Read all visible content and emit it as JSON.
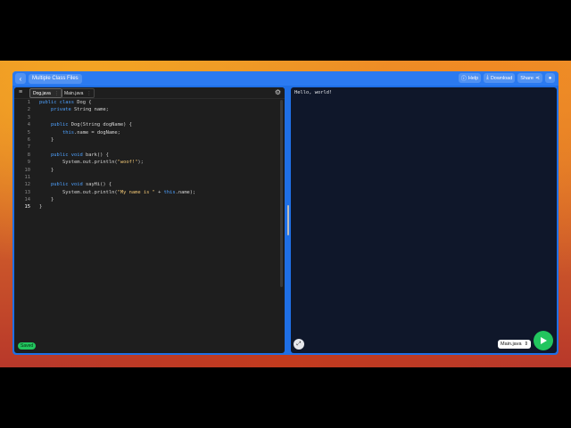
{
  "topbar": {
    "title": "Multiple Class Files",
    "help_label": "Help",
    "download_label": "Download",
    "share_label": "Share"
  },
  "editor": {
    "tabs": [
      {
        "label": "Dog.java",
        "active": true
      },
      {
        "label": "Main.java",
        "active": false
      }
    ],
    "lines": [
      "1",
      "2",
      "3",
      "4",
      "5",
      "6",
      "7",
      "8",
      "9",
      "10",
      "11",
      "12",
      "13",
      "14",
      "15"
    ],
    "saved_label": "Saved"
  },
  "output": {
    "text": "Hello, world!",
    "run_file": "Main.java"
  },
  "colors": {
    "accent": "#2b7af0",
    "editor_bg": "#1e1e1e",
    "output_bg": "#0f172a",
    "run_green": "#22c55e"
  }
}
